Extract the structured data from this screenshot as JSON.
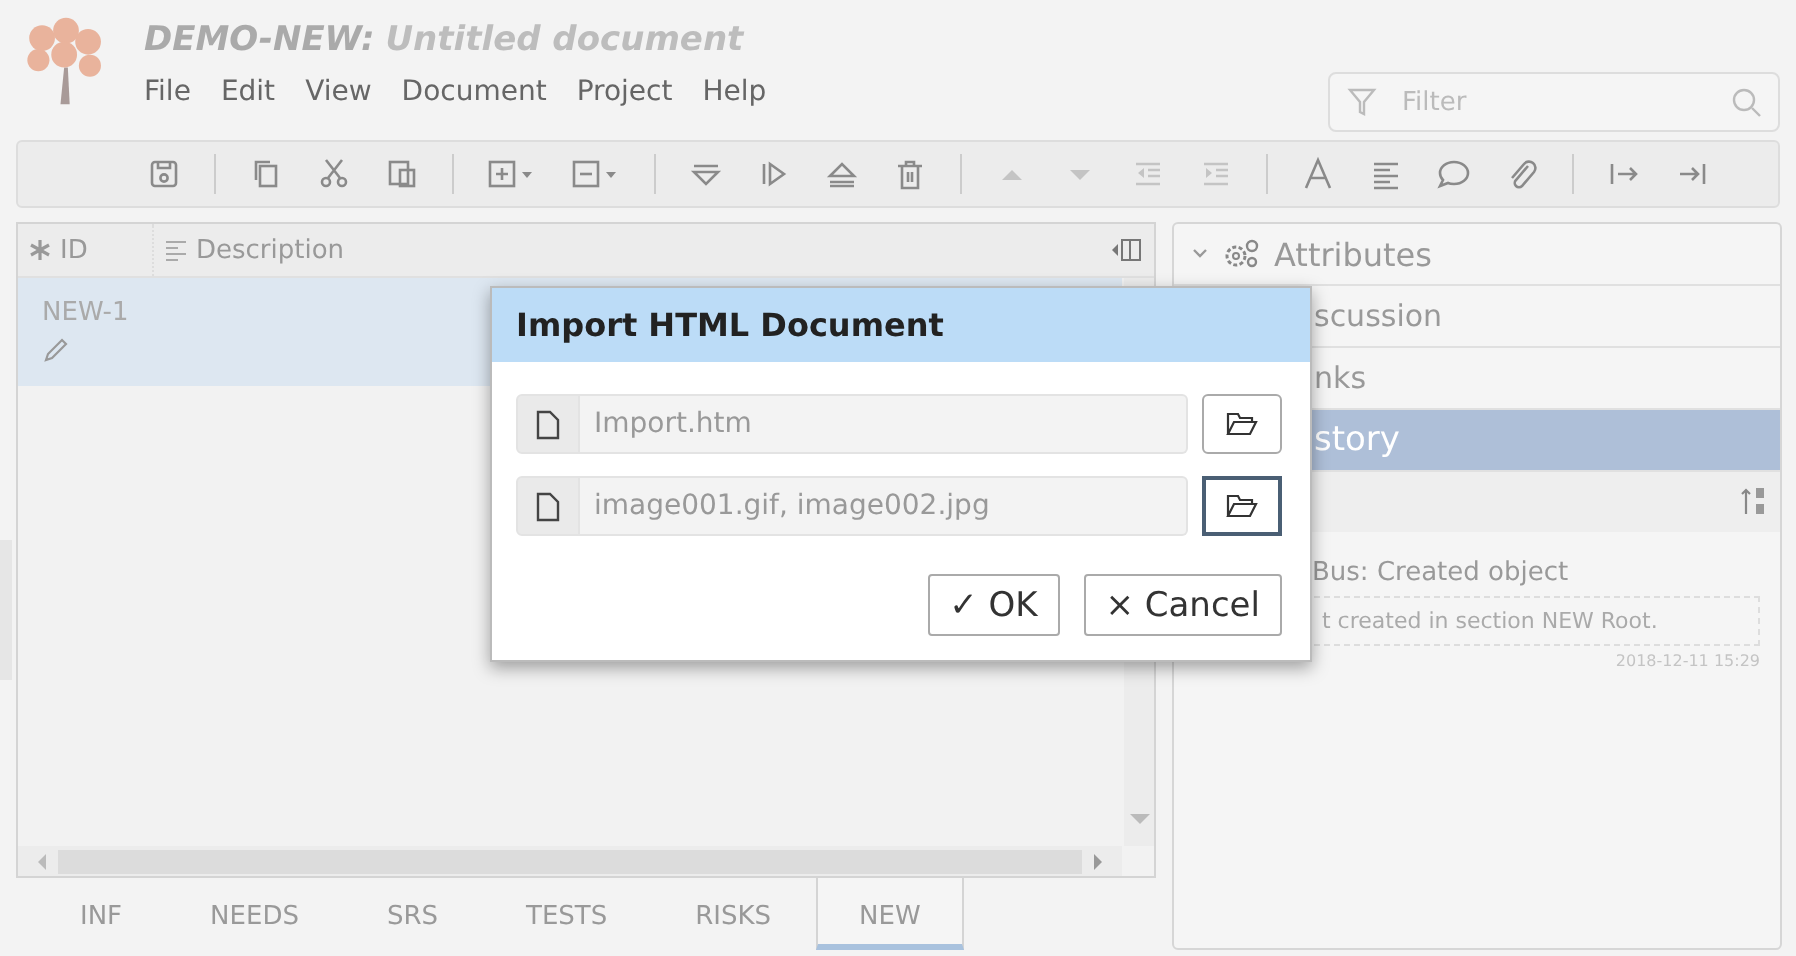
{
  "window": {
    "app": "DEMO-NEW:",
    "title": "Untitled document"
  },
  "menu": [
    "File",
    "Edit",
    "View",
    "Document",
    "Project",
    "Help"
  ],
  "filter": {
    "placeholder": "Filter"
  },
  "table": {
    "columns": [
      "ID",
      "Description"
    ],
    "rows": [
      {
        "id": "NEW-1",
        "selected": true
      }
    ]
  },
  "doc_tabs": [
    {
      "label": "INF",
      "selected": false
    },
    {
      "label": "NEEDS",
      "selected": false
    },
    {
      "label": "SRS",
      "selected": false
    },
    {
      "label": "TESTS",
      "selected": false
    },
    {
      "label": "RISKS",
      "selected": false
    },
    {
      "label": "NEW",
      "selected": true
    }
  ],
  "side_panel": {
    "sections": [
      {
        "label": "Attributes",
        "kind": "header",
        "selected": false
      },
      {
        "label": "scussion",
        "kind": "item",
        "selected": false
      },
      {
        "label": "nks",
        "kind": "item",
        "selected": false
      },
      {
        "label": "story",
        "kind": "item",
        "selected": true
      }
    ],
    "history": {
      "entry": "Bus: Created object",
      "detail": "t created in section NEW Root.",
      "time": "2018-12-11 15:29"
    }
  },
  "dialog": {
    "title": "Import HTML Document",
    "fields": [
      {
        "value": "Import.htm",
        "focused": false
      },
      {
        "value": "image001.gif, image002.jpg",
        "focused": true
      }
    ],
    "buttons": [
      {
        "label": "OK",
        "icon": "✓"
      },
      {
        "label": "Cancel",
        "icon": "×"
      }
    ]
  }
}
